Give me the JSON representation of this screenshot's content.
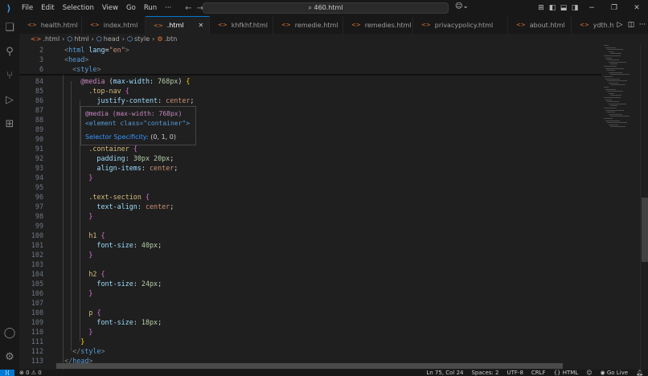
{
  "titlebar": {
    "menu": [
      "File",
      "Edit",
      "Selection",
      "View",
      "Go",
      "Run",
      "···"
    ],
    "nav_back": "←",
    "nav_fwd": "→",
    "search": "⌕ 460.html"
  },
  "activity": [
    "files-icon",
    "search-icon",
    "source-control-icon",
    "run-debug-icon",
    "extensions-icon"
  ],
  "tabs": [
    {
      "label": "health.html"
    },
    {
      "label": "index.html"
    },
    {
      "label": ".html",
      "active": true,
      "close": "✕"
    },
    {
      "label": "khfkhf.html"
    },
    {
      "label": "remedie.html"
    },
    {
      "label": "remedies.html"
    },
    {
      "label": "privacypolicy.html"
    },
    {
      "label": "about.html"
    },
    {
      "label": "ydth.html"
    }
  ],
  "breadcrumb": [
    ".html",
    "html",
    "head",
    "style",
    ".btn"
  ],
  "sticky": [
    {
      "num": "2",
      "tokens": [
        [
          "  ",
          ""
        ],
        [
          "<",
          "ang"
        ],
        [
          "html",
          "tag"
        ],
        [
          " lang",
          "attr"
        ],
        [
          "=",
          "pun"
        ],
        [
          "\"en\"",
          "val"
        ],
        [
          ">",
          "ang"
        ]
      ]
    },
    {
      "num": "3",
      "tokens": [
        [
          "  ",
          ""
        ],
        [
          "<",
          "ang"
        ],
        [
          "head",
          "tag"
        ],
        [
          ">",
          "ang"
        ]
      ]
    },
    {
      "num": "6",
      "tokens": [
        [
          "    ",
          ""
        ],
        [
          "<",
          "ang"
        ],
        [
          "style",
          "tag"
        ],
        [
          ">",
          "ang"
        ]
      ]
    }
  ],
  "code": [
    {
      "num": "84",
      "tokens": [
        [
          "      ",
          ""
        ],
        [
          "@media",
          "kw"
        ],
        [
          " (",
          "pun"
        ],
        [
          "max-width",
          "prop"
        ],
        [
          ": ",
          "pun"
        ],
        [
          "768px",
          "num"
        ],
        [
          ") ",
          "pun"
        ],
        [
          "{",
          "br"
        ]
      ]
    },
    {
      "num": "85",
      "tokens": [
        [
          "        ",
          ""
        ],
        [
          ".top-nav",
          "sel"
        ],
        [
          " ",
          ""
        ],
        [
          "{",
          "br2"
        ]
      ]
    },
    {
      "num": "86",
      "tokens": [
        [
          "          ",
          ""
        ],
        [
          "justify-content",
          "prop"
        ],
        [
          ": ",
          "pun"
        ],
        [
          "center",
          "val"
        ],
        [
          ";",
          "pun"
        ]
      ]
    },
    {
      "num": "87",
      "tokens": []
    },
    {
      "num": "88",
      "tokens": []
    },
    {
      "num": "89",
      "tokens": []
    },
    {
      "num": "90",
      "tokens": []
    },
    {
      "num": "91",
      "tokens": [
        [
          "        ",
          ""
        ],
        [
          ".container",
          "sel"
        ],
        [
          " ",
          ""
        ],
        [
          "{",
          "br2"
        ]
      ]
    },
    {
      "num": "92",
      "tokens": [
        [
          "          ",
          ""
        ],
        [
          "padding",
          "prop"
        ],
        [
          ": ",
          "pun"
        ],
        [
          "30px 20px",
          "num"
        ],
        [
          ";",
          "pun"
        ]
      ]
    },
    {
      "num": "93",
      "tokens": [
        [
          "          ",
          ""
        ],
        [
          "align-items",
          "prop"
        ],
        [
          ": ",
          "pun"
        ],
        [
          "center",
          "val"
        ],
        [
          ";",
          "pun"
        ]
      ]
    },
    {
      "num": "94",
      "tokens": [
        [
          "        ",
          ""
        ],
        [
          "}",
          "br2"
        ]
      ]
    },
    {
      "num": "95",
      "tokens": []
    },
    {
      "num": "96",
      "tokens": [
        [
          "        ",
          ""
        ],
        [
          ".text-section",
          "sel"
        ],
        [
          " ",
          ""
        ],
        [
          "{",
          "br2"
        ]
      ]
    },
    {
      "num": "97",
      "tokens": [
        [
          "          ",
          ""
        ],
        [
          "text-align",
          "prop"
        ],
        [
          ": ",
          "pun"
        ],
        [
          "center",
          "val"
        ],
        [
          ";",
          "pun"
        ]
      ]
    },
    {
      "num": "98",
      "tokens": [
        [
          "        ",
          ""
        ],
        [
          "}",
          "br2"
        ]
      ]
    },
    {
      "num": "99",
      "tokens": []
    },
    {
      "num": "100",
      "tokens": [
        [
          "        ",
          ""
        ],
        [
          "h1",
          "sel"
        ],
        [
          " ",
          ""
        ],
        [
          "{",
          "br2"
        ]
      ]
    },
    {
      "num": "101",
      "tokens": [
        [
          "          ",
          ""
        ],
        [
          "font-size",
          "prop"
        ],
        [
          ": ",
          "pun"
        ],
        [
          "40px",
          "num"
        ],
        [
          ";",
          "pun"
        ]
      ]
    },
    {
      "num": "102",
      "tokens": [
        [
          "        ",
          ""
        ],
        [
          "}",
          "br2"
        ]
      ]
    },
    {
      "num": "103",
      "tokens": []
    },
    {
      "num": "104",
      "tokens": [
        [
          "        ",
          ""
        ],
        [
          "h2",
          "sel"
        ],
        [
          " ",
          ""
        ],
        [
          "{",
          "br2"
        ]
      ]
    },
    {
      "num": "105",
      "tokens": [
        [
          "          ",
          ""
        ],
        [
          "font-size",
          "prop"
        ],
        [
          ": ",
          "pun"
        ],
        [
          "24px",
          "num"
        ],
        [
          ";",
          "pun"
        ]
      ]
    },
    {
      "num": "106",
      "tokens": [
        [
          "        ",
          ""
        ],
        [
          "}",
          "br2"
        ]
      ]
    },
    {
      "num": "107",
      "tokens": []
    },
    {
      "num": "108",
      "tokens": [
        [
          "        ",
          ""
        ],
        [
          "p",
          "sel"
        ],
        [
          " ",
          ""
        ],
        [
          "{",
          "br2"
        ]
      ]
    },
    {
      "num": "109",
      "tokens": [
        [
          "          ",
          ""
        ],
        [
          "font-size",
          "prop"
        ],
        [
          ": ",
          "pun"
        ],
        [
          "18px",
          "num"
        ],
        [
          ";",
          "pun"
        ]
      ]
    },
    {
      "num": "110",
      "tokens": [
        [
          "        ",
          ""
        ],
        [
          "}",
          "br2"
        ]
      ]
    },
    {
      "num": "111",
      "tokens": [
        [
          "      ",
          ""
        ],
        [
          "}",
          "br"
        ]
      ]
    },
    {
      "num": "112",
      "tokens": [
        [
          "    ",
          ""
        ],
        [
          "</",
          "ang"
        ],
        [
          "style",
          "tag"
        ],
        [
          ">",
          "ang"
        ]
      ]
    },
    {
      "num": "113",
      "tokens": [
        [
          "  ",
          ""
        ],
        [
          "</",
          "ang"
        ],
        [
          "head",
          "tag"
        ],
        [
          ">",
          "ang"
        ]
      ]
    }
  ],
  "hover": {
    "line1": "@media (max-width: 768px)",
    "line2": "<element class=\"container\">",
    "spec_label": "Selector Specificity:",
    "spec_value": "(0, 1, 0)"
  },
  "status": {
    "problems": "⊗ 0 ⚠ 0",
    "position": "Ln 75, Col 24",
    "spaces": "Spaces: 2",
    "encoding": "UTF-8",
    "eol": "CRLF",
    "language": "{} HTML",
    "golive": "Go Live"
  }
}
